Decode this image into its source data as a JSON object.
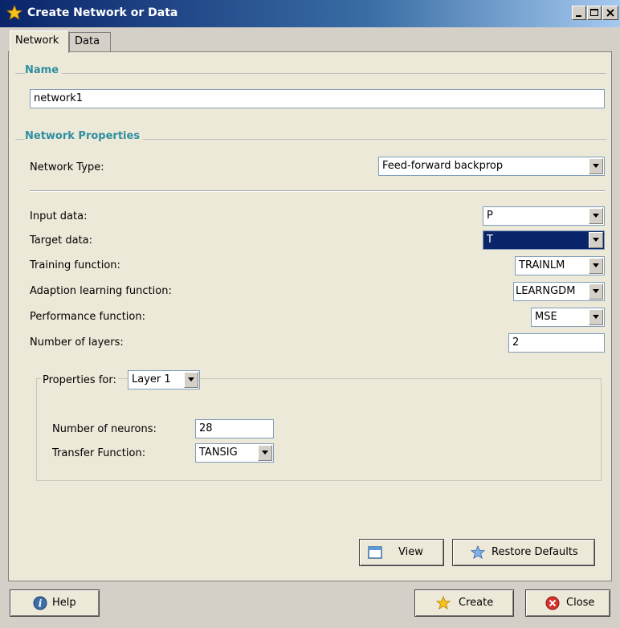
{
  "window": {
    "title": "Create Network or Data",
    "controls": [
      "minimize",
      "maximize",
      "close"
    ]
  },
  "tabs": [
    {
      "label": "Network",
      "active": true
    },
    {
      "label": "Data",
      "active": false
    }
  ],
  "name_section": {
    "title": "Name",
    "value": "network1"
  },
  "network_properties": {
    "title": "Network Properties",
    "network_type_label": "Network Type:",
    "network_type_value": "Feed-forward backprop",
    "input_data_label": "Input data:",
    "input_data_value": "P",
    "target_data_label": "Target data:",
    "target_data_value": "T",
    "training_function_label": "Training function:",
    "training_function_value": "TRAINLM",
    "adaption_label": "Adaption learning function:",
    "adaption_value": "LEARNGDM",
    "performance_label": "Performance function:",
    "performance_value": "MSE",
    "layers_label": "Number of layers:",
    "layers_value": "2"
  },
  "layer_properties": {
    "properties_for_label": "Properties for:",
    "layer_value": "Layer 1",
    "neurons_label": "Number of neurons:",
    "neurons_value": "28",
    "transfer_label": "Transfer Function:",
    "transfer_value": "TANSIG"
  },
  "buttons": {
    "view": "View",
    "restore": "Restore Defaults",
    "help": "Help",
    "create": "Create",
    "close": "Close"
  },
  "colors": {
    "section_title": "#2e8fa0",
    "selection": "#0a246a"
  }
}
